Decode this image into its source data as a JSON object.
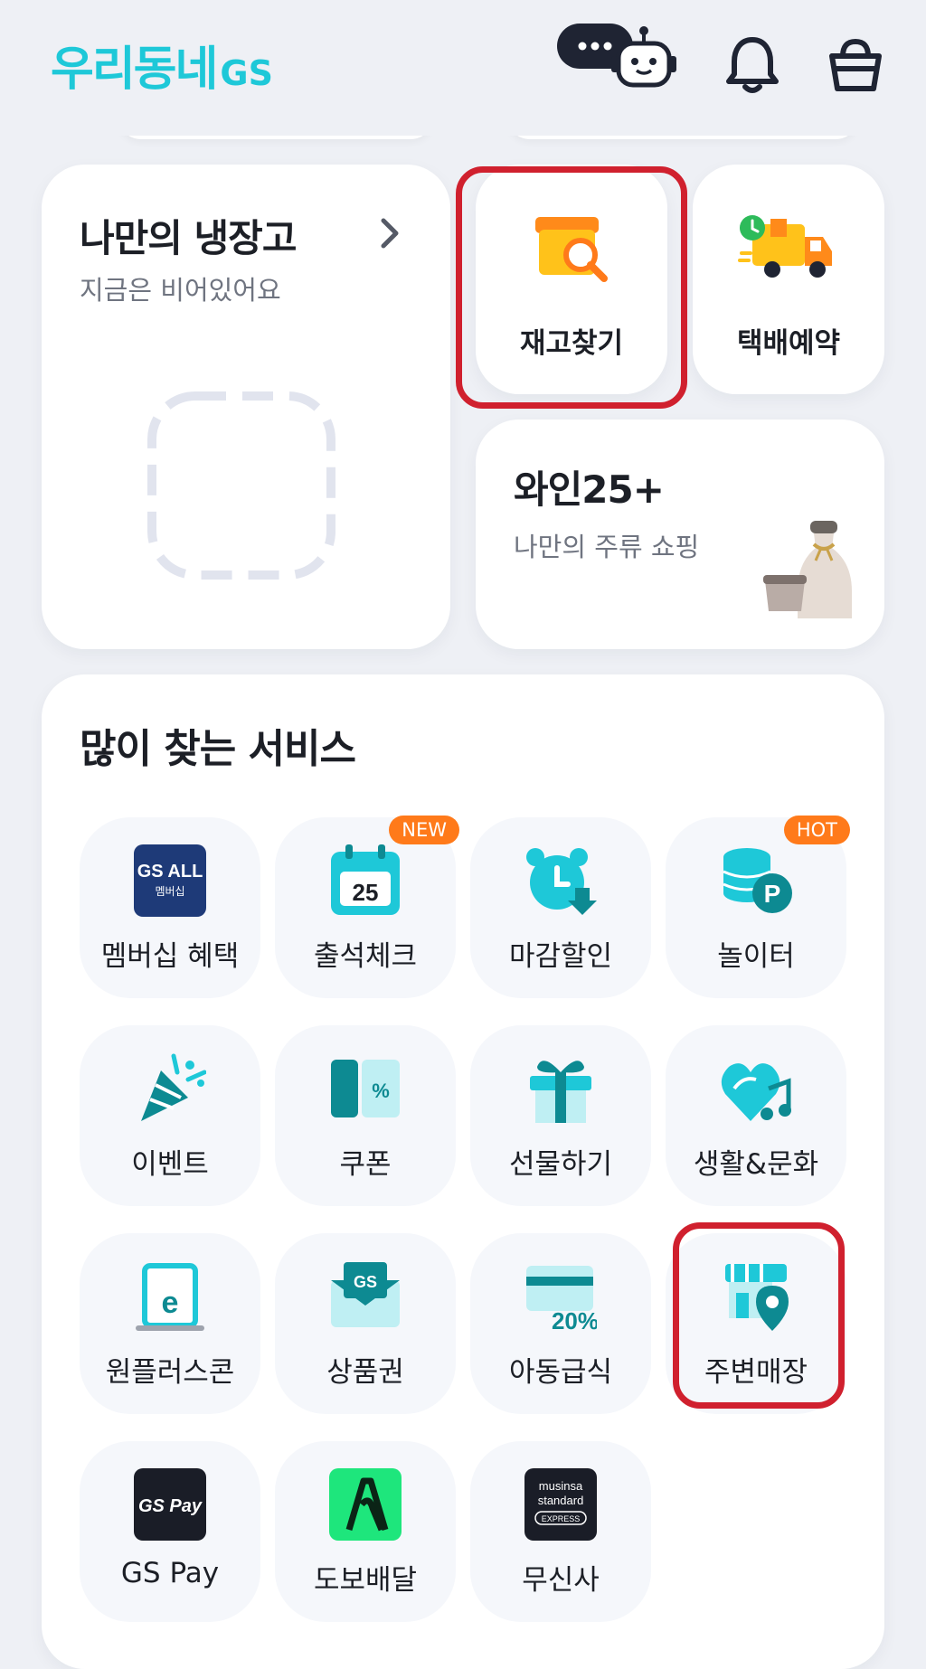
{
  "header": {
    "logo": "우리동네",
    "logo_suffix": "GS",
    "chat_icon": "chatbot-icon",
    "bell_icon": "bell-icon",
    "cart_icon": "basket-icon"
  },
  "fridge": {
    "title": "나만의 냉장고",
    "subtitle": "지금은 비어있어요"
  },
  "quick_tiles": [
    {
      "label": "재고찾기",
      "icon": "stock-search-icon"
    },
    {
      "label": "택배예약",
      "icon": "delivery-truck-icon"
    }
  ],
  "wine": {
    "title": "와인25+",
    "subtitle": "나만의 주류 쇼핑"
  },
  "services": {
    "title": "많이 찾는 서비스",
    "items": [
      {
        "label": "멤버십 혜택",
        "icon": "membership-icon",
        "icon_text": "GS ALL",
        "icon_sub": "멤버십"
      },
      {
        "label": "출석체크",
        "icon": "calendar-icon",
        "icon_text": "25",
        "badge": "NEW"
      },
      {
        "label": "마감할인",
        "icon": "alarm-clock-icon"
      },
      {
        "label": "놀이터",
        "icon": "points-icon",
        "icon_text": "P",
        "badge": "HOT"
      },
      {
        "label": "이벤트",
        "icon": "party-popper-icon"
      },
      {
        "label": "쿠폰",
        "icon": "coupon-icon",
        "icon_text": "%"
      },
      {
        "label": "선물하기",
        "icon": "gift-icon"
      },
      {
        "label": "생활&문화",
        "icon": "heart-music-icon"
      },
      {
        "label": "원플러스콘",
        "icon": "e-coupon-icon",
        "icon_text": "e"
      },
      {
        "label": "상품권",
        "icon": "gift-card-icon",
        "icon_text": "GS"
      },
      {
        "label": "아동급식",
        "icon": "meal-card-icon",
        "icon_text": "20%"
      },
      {
        "label": "주변매장",
        "icon": "store-location-icon"
      },
      {
        "label": "GS Pay",
        "icon": "gs-pay-icon",
        "icon_text": "GS Pay"
      },
      {
        "label": "도보배달",
        "icon": "walking-delivery-icon"
      },
      {
        "label": "무신사",
        "icon": "musinsa-icon",
        "icon_text": "musinsa",
        "icon_sub": "standard",
        "icon_sub2": "EXPRESS"
      }
    ]
  },
  "colors": {
    "accent": "#1ec8d8",
    "highlight": "#d0202e",
    "badge": "#ff7a1a",
    "background": "#eef0f5"
  }
}
